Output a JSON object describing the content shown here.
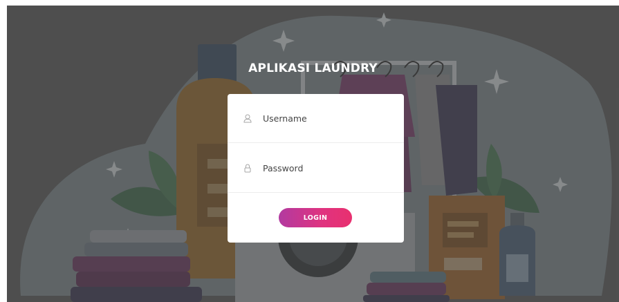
{
  "app": {
    "title": "APLIKASI LAUNDRY"
  },
  "login_form": {
    "username_placeholder": "Username",
    "password_placeholder": "Password",
    "username_icon": "user-icon",
    "password_icon": "lock-icon",
    "login_label": "LOGIN"
  },
  "colors": {
    "button_gradient_start": "#b23aa0",
    "button_gradient_end": "#e8306f",
    "card_background": "#ffffff",
    "overlay": "#5a5a5a"
  }
}
